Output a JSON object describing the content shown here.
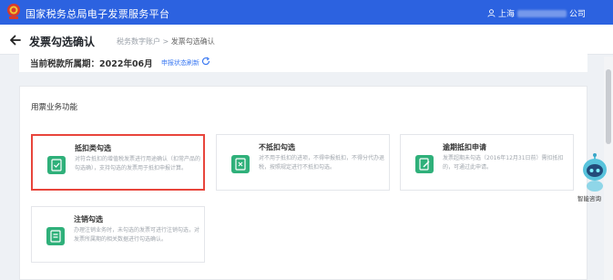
{
  "app": {
    "title": "国家税务总局电子发票服务平台"
  },
  "user": {
    "city": "上海",
    "suffix": "公司"
  },
  "header": {
    "title": "发票勾选确认",
    "breadcrumb": {
      "parent": "税务数字账户",
      "separator": ">",
      "current": "发票勾选确认"
    }
  },
  "period": {
    "label": "当前税款所属期：2022年06月",
    "link": "申报状态刷新"
  },
  "section": {
    "title": "用票业务功能"
  },
  "cards": [
    {
      "title": "抵扣类勾选",
      "desc": "对符合抵扣的增值税发票进行用途确认（扣常产品的勾选确），支持勾选的发票用于抵扣申报计算。",
      "selected": true
    },
    {
      "title": "不抵扣勾选",
      "desc": "对不用于抵扣的进项，不得申报抵扣，不得分代办退税，按照规定进行不抵扣勾选。",
      "selected": false
    },
    {
      "title": "逾期抵扣申请",
      "desc": "发票超期未勾选（2016年12月31日前）需扣抵扣的，可通过此申请。",
      "selected": false
    },
    {
      "title": "注销勾选",
      "desc": "办理注销业务时，未勾选的发票可进行注销勾选，对发票所属期的相关数据进行勾选确认。",
      "selected": false
    }
  ],
  "assistant": {
    "label": "智能咨询"
  },
  "colors": {
    "topbar": "#2c62e0",
    "accent": "#3a78f2",
    "selected_border": "#e8453c",
    "icon_green": "#2fb07a"
  }
}
